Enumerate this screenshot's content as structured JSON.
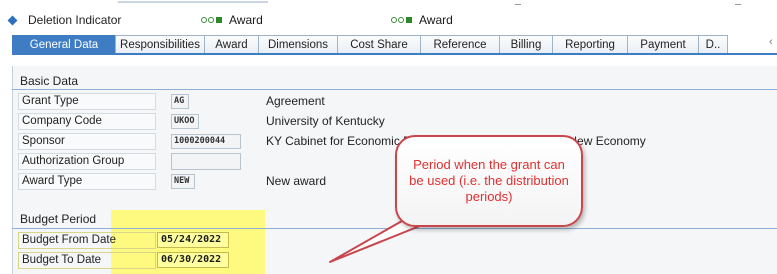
{
  "header": {
    "deletion_indicator": "Deletion Indicator",
    "status_left_label": "Award",
    "status_right_label": "Award"
  },
  "tabs": [
    {
      "label": "General Data",
      "active": true
    },
    {
      "label": "Responsibilities"
    },
    {
      "label": "Award"
    },
    {
      "label": "Dimensions"
    },
    {
      "label": "Cost Share"
    },
    {
      "label": "Reference"
    },
    {
      "label": "Billing"
    },
    {
      "label": "Reporting"
    },
    {
      "label": "Payment"
    },
    {
      "label": "D.."
    }
  ],
  "basic_data": {
    "title": "Basic Data",
    "rows": [
      {
        "label": "Grant Type",
        "value": "AG",
        "description": "Agreement"
      },
      {
        "label": "Company Code",
        "value": "UKOO",
        "description": "University of Kentucky"
      },
      {
        "label": "Sponsor",
        "value": "1000200044",
        "description": "KY Cabinet for Economic Development c/o Office for the New Economy"
      },
      {
        "label": "Authorization Group",
        "value": "",
        "description": ""
      },
      {
        "label": "Award Type",
        "value": "NEW",
        "description": "New award"
      }
    ]
  },
  "budget_period": {
    "title": "Budget Period",
    "from_label": "Budget From Date",
    "from_value": "05/24/2022",
    "to_label": "Budget To Date",
    "to_value": "06/30/2022"
  },
  "callout": {
    "text": "Period when the grant can be used (i.e. the distribution periods)"
  },
  "colors": {
    "tab_active": "#3e7cc4",
    "highlight": "#fffa6b",
    "callout_border": "#c9474c",
    "callout_text": "#e0302f"
  }
}
